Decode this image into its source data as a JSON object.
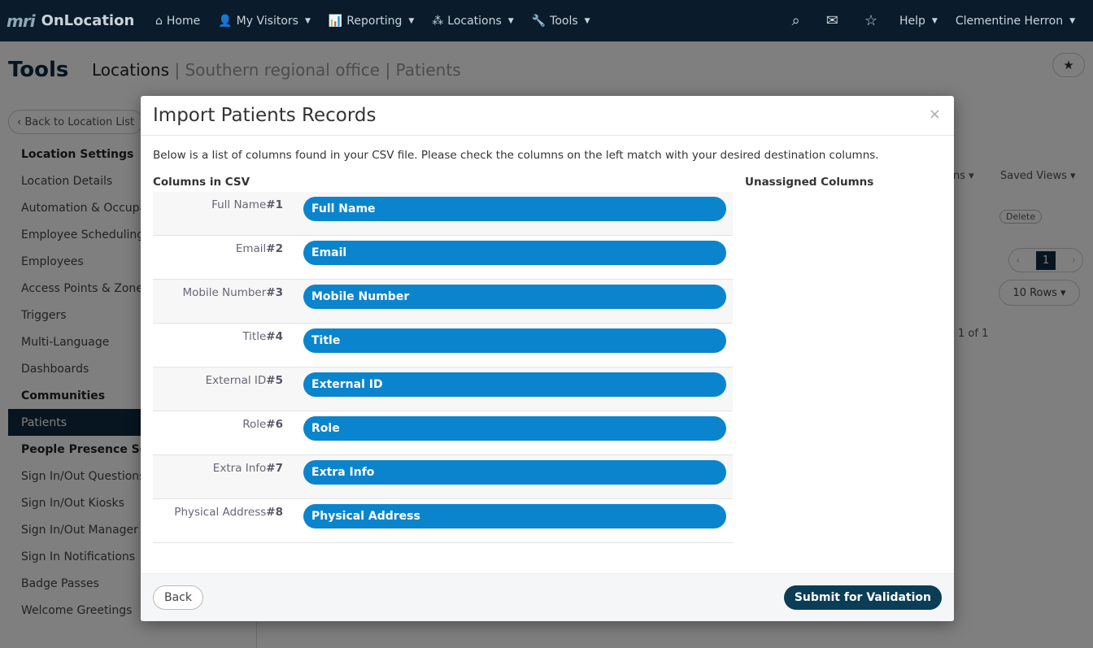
{
  "nav": {
    "brand_mark": "mri",
    "brand_name": "OnLocation",
    "home": "Home",
    "my_visitors": "My Visitors",
    "reporting": "Reporting",
    "locations": "Locations",
    "tools": "Tools",
    "help": "Help",
    "user": "Clementine Herron"
  },
  "page": {
    "title": "Tools",
    "crumb_main": "Locations",
    "crumb_sub": " | Southern regional office | Patients",
    "back_label": "Back to Location List",
    "saved_views": "Saved Views",
    "columns_partial": "ns",
    "delete": "Delete",
    "page_num": "1",
    "page_of": "1 of 1",
    "rows": "10 Rows"
  },
  "sidebar": [
    {
      "label": "Location Settings",
      "type": "head"
    },
    {
      "label": "Location Details",
      "type": "item"
    },
    {
      "label": "Automation & Occupancy",
      "type": "item"
    },
    {
      "label": "Employee Scheduling",
      "type": "item"
    },
    {
      "label": "Employees",
      "type": "item"
    },
    {
      "label": "Access Points & Zones",
      "type": "item"
    },
    {
      "label": "Triggers",
      "type": "item"
    },
    {
      "label": "Multi-Language",
      "type": "item"
    },
    {
      "label": "Dashboards",
      "type": "item"
    },
    {
      "label": "Communities",
      "type": "head"
    },
    {
      "label": "Patients",
      "type": "active"
    },
    {
      "label": "People Presence Settings",
      "type": "head"
    },
    {
      "label": "Sign In/Out Questions",
      "type": "item"
    },
    {
      "label": "Sign In/Out Kiosks",
      "type": "item"
    },
    {
      "label": "Sign In/Out Manager",
      "type": "item"
    },
    {
      "label": "Sign In Notifications",
      "type": "item"
    },
    {
      "label": "Badge Passes",
      "type": "item"
    },
    {
      "label": "Welcome Greetings",
      "type": "item"
    }
  ],
  "modal": {
    "title": "Import Patients Records",
    "close": "×",
    "intro": "Below is a list of columns found in your CSV file. Please check the columns on the left match with your desired destination columns.",
    "csv_heading": "Columns in CSV",
    "unassigned_heading": "Unassigned Columns",
    "rows": [
      {
        "label": "Full Name",
        "hash": "#1",
        "dest": "Full Name"
      },
      {
        "label": "Email",
        "hash": "#2",
        "dest": "Email"
      },
      {
        "label": "Mobile Number",
        "hash": "#3",
        "dest": "Mobile Number"
      },
      {
        "label": "Title",
        "hash": "#4",
        "dest": "Title"
      },
      {
        "label": "External ID",
        "hash": "#5",
        "dest": "External ID"
      },
      {
        "label": "Role",
        "hash": "#6",
        "dest": "Role"
      },
      {
        "label": "Extra Info",
        "hash": "#7",
        "dest": "Extra Info"
      },
      {
        "label": "Physical Address",
        "hash": "#8",
        "dest": "Physical Address"
      }
    ],
    "back_button": "Back",
    "submit_button": "Submit for Validation"
  },
  "colors": {
    "nav_bg": "#0a1c2b",
    "pill": "#0a85cd",
    "submit": "#0b3d56",
    "active_sidebar": "#0d2a3f"
  },
  "icons": [
    "home-icon",
    "user-icon",
    "chart-icon",
    "network-icon",
    "wrench-icon",
    "search-icon",
    "envelope-icon",
    "star-icon",
    "close-icon"
  ]
}
